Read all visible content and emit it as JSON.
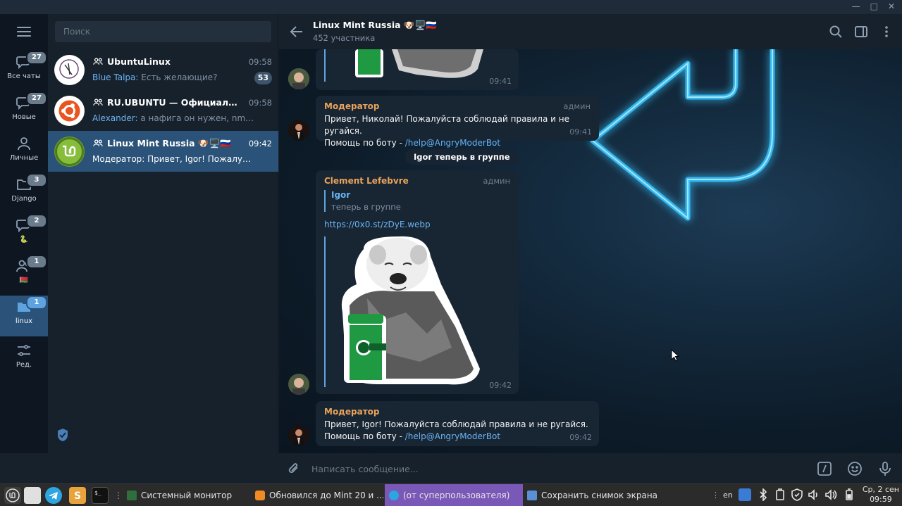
{
  "window": {
    "minimize": "—",
    "maximize": "□",
    "close": "✕"
  },
  "folders": [
    {
      "label": "Все чаты",
      "badge": "27",
      "icon": "chats-icon"
    },
    {
      "label": "Новые",
      "badge": "27",
      "icon": "new-chats-icon"
    },
    {
      "label": "Личные",
      "badge": "",
      "icon": "person-icon"
    },
    {
      "label": "Django",
      "badge": "3",
      "icon": "folder-icon"
    },
    {
      "label": "🐍",
      "badge": "2",
      "icon": "snake-emoji"
    },
    {
      "label": "🇧🇾",
      "badge": "1",
      "icon": "flag-emoji"
    },
    {
      "label": "linux",
      "badge": "1",
      "icon": "folder-icon",
      "active": true
    },
    {
      "label": "Ред.",
      "badge": "",
      "icon": "edit-folders-icon"
    }
  ],
  "search": {
    "placeholder": "Поиск"
  },
  "chats": [
    {
      "name": "UbuntuLinux",
      "time": "09:58",
      "sender": "Blue Talpa:",
      "preview": " Есть желающие?",
      "unread": "53"
    },
    {
      "name": "RU.UBUNTU — Официальное со...",
      "time": "09:58",
      "sender": "Alexander:",
      "preview": " а нафига он нужен, nm давно у",
      "unread": ""
    },
    {
      "name": "Linux Mint Russia 🐶🖥️🇷🇺",
      "time": "09:42",
      "sender": "",
      "preview": "Модератор: Привет, Igor! Пожалуйста со...",
      "unread": "",
      "active": true
    }
  ],
  "header": {
    "title": "Linux Mint Russia 🐶🖥️🇷🇺",
    "subtitle": "452 участника"
  },
  "messages": {
    "m0": {
      "time": "09:41"
    },
    "m1": {
      "author": "Модератор",
      "role": "админ",
      "line1": "Привет, Николай! Пожалуйста соблюдай правила и не ругайся.",
      "line2_prefix": "Помощь по боту - ",
      "link": "/help@AngryModerBot",
      "time": "09:41"
    },
    "service": "Igor теперь в группе",
    "m2": {
      "author": "Clement Lefebvre",
      "role": "админ",
      "quote_name": "Igor",
      "quote_text": "теперь в группе",
      "url": "https://0x0.st/zDyE.webp",
      "time": "09:42"
    },
    "m3": {
      "author": "Модератор",
      "line1": "Привет, Igor! Пожалуйста соблюдай правила и не ругайся.",
      "line2_prefix": "Помощь по боту - ",
      "link": "/help@AngryModerBot",
      "time": "09:42"
    }
  },
  "composer": {
    "placeholder": "Написать сообщение..."
  },
  "taskbar": {
    "tasks": [
      {
        "label": "Системный монитор",
        "icon": "system-monitor-icon"
      },
      {
        "label": "Обновился до Mint 20 и ...",
        "icon": "browser-icon"
      },
      {
        "label": "(от суперпользователя)",
        "icon": "telegram-icon",
        "active": true
      },
      {
        "label": "Сохранить снимок экрана",
        "icon": "screenshot-icon"
      }
    ],
    "lang": "en",
    "clock_date": "Ср, 2 сен",
    "clock_time": "09:59"
  },
  "colors": {
    "accent": "#5ea3e0",
    "active_folder": "#2b5278",
    "author": "#e9a35a",
    "link": "#6ab3f3",
    "taskbar_active": "#7a58b7"
  }
}
